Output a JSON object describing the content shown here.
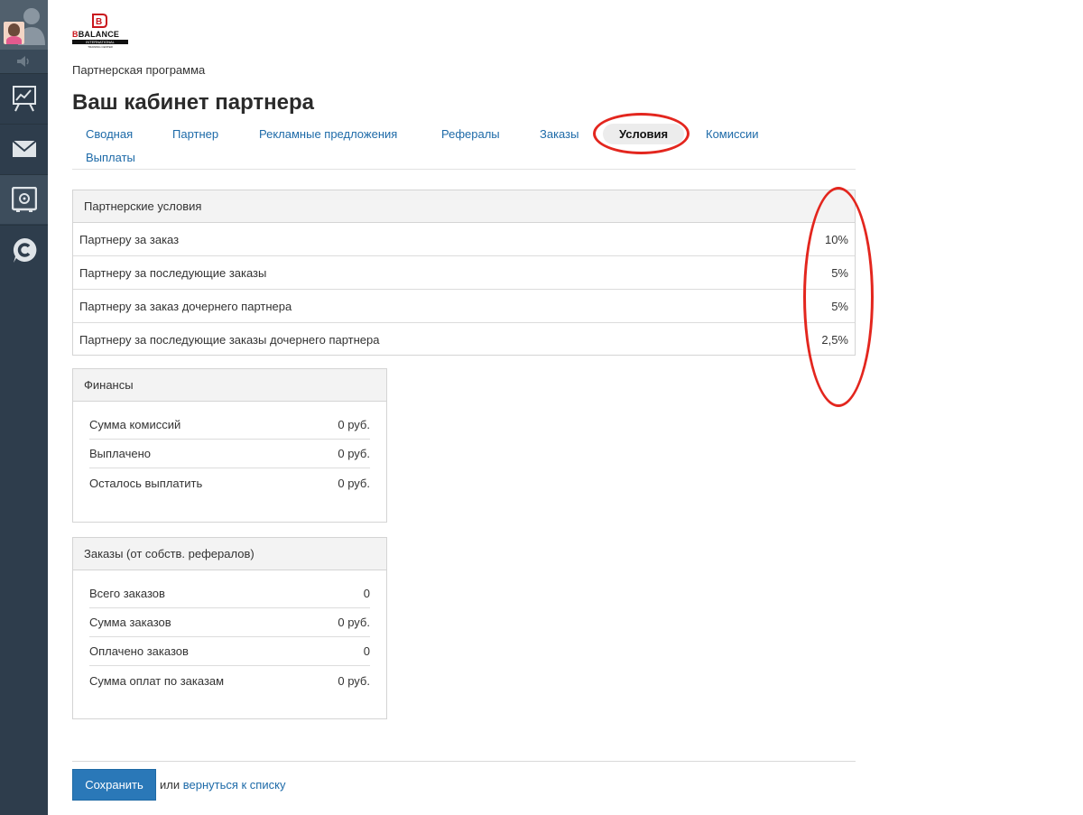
{
  "sidebar": {
    "items": [
      {
        "icon": "chart-easel-icon"
      },
      {
        "icon": "mail-icon"
      },
      {
        "icon": "safe-icon"
      },
      {
        "icon": "chat-c-icon"
      }
    ]
  },
  "brand": {
    "logo_text": "BALANCE",
    "logo_sub": "INTERNATIONAL",
    "logo_sub2": "TRAINING CENTER"
  },
  "header": {
    "subtitle": "Партнерская программа",
    "title": "Ваш кабинет партнера"
  },
  "tabs": [
    {
      "label": "Сводная"
    },
    {
      "label": "Партнер"
    },
    {
      "label": "Рекламные предложения"
    },
    {
      "label": "Рефералы"
    },
    {
      "label": "Заказы"
    },
    {
      "label": "Условия",
      "active": true
    },
    {
      "label": "Комиссии"
    },
    {
      "label": "Выплаты"
    }
  ],
  "conditions": {
    "title": "Партнерские условия",
    "rows": [
      {
        "label": "Партнеру за заказ",
        "value": "10%"
      },
      {
        "label": "Партнеру за последующие заказы",
        "value": "5%"
      },
      {
        "label": "Партнеру за заказ дочернего партнера",
        "value": "5%"
      },
      {
        "label": "Партнеру за последующие заказы дочернего партнера",
        "value": "2,5%"
      }
    ]
  },
  "finances": {
    "title": "Финансы",
    "rows": [
      {
        "label": "Сумма комиссий",
        "value": "0 руб."
      },
      {
        "label": "Выплачено",
        "value": "0 руб."
      },
      {
        "label": "Осталось выплатить",
        "value": "0 руб."
      }
    ]
  },
  "orders": {
    "title": "Заказы (от собств. рефералов)",
    "rows": [
      {
        "label": "Всего заказов",
        "value": "0"
      },
      {
        "label": "Сумма заказов",
        "value": "0 руб."
      },
      {
        "label": "Оплачено заказов",
        "value": "0"
      },
      {
        "label": "Сумма оплат по заказам",
        "value": "0 руб."
      }
    ]
  },
  "footer": {
    "save_label": "Сохранить",
    "or_text": "или",
    "back_link": "вернуться к списку"
  },
  "colors": {
    "accent": "#2a78b8",
    "link": "#1d6aa8",
    "highlight": "#e3261e",
    "sidebar": "#2e3d4c"
  }
}
